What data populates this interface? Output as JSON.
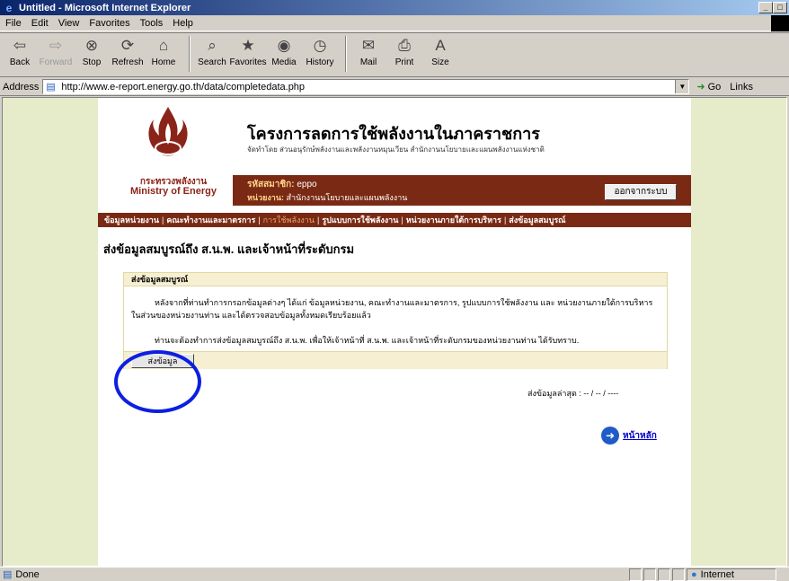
{
  "window": {
    "title": "Untitled - Microsoft Internet Explorer",
    "buttons": [
      "_",
      "ŏ"
    ]
  },
  "menu": [
    "File",
    "Edit",
    "View",
    "Favorites",
    "Tools",
    "Help"
  ],
  "toolbar": {
    "back": "Back",
    "forward": "Forward",
    "stop": "Stop",
    "refresh": "Refresh",
    "home": "Home",
    "search": "Search",
    "favorites": "Favorites",
    "media": "Media",
    "history": "History",
    "mail": "Mail",
    "print": "Print",
    "size": "Size"
  },
  "address": {
    "label": "Address",
    "url": "http://www.e-report.energy.go.th/data/completedata.php",
    "go": "Go",
    "links": "Links"
  },
  "header": {
    "ministry_th": "กระทรวงพลังงาน",
    "ministry_en": "Ministry of Energy",
    "project_title": "โครงการลดการใช้พลังงานในภาคราชการ",
    "project_sub": "จัดทำโดย ส่วนอนุรักษ์พลังงานและพลังงานหมุนเวียน สำนักงานนโยบายและแผนพลังงานแห่งชาติ"
  },
  "member": {
    "id_label": "รหัสสมาชิก:",
    "id_value": "eppo",
    "unit_label": "หน่วยงาน:",
    "unit_value": "สำนักงานนโยบายและแผนพลังงาน",
    "logout": "ออกจากระบบ"
  },
  "nav": [
    {
      "label": "ข้อมูลหน่วยงาน"
    },
    {
      "label": "คณะทำงานและมาตรการ"
    },
    {
      "label": "การใช้พลังงาน"
    },
    {
      "label": "รูปแบบการใช้พลังงาน"
    },
    {
      "label": "หน่วยงานภายใต้การบริหาร"
    },
    {
      "label": "ส่งข้อมูลสมบูรณ์"
    }
  ],
  "main": {
    "heading": "ส่งข้อมูลสมบูรณ์ถึง ส.น.พ. และเจ้าหน้าที่ระดับกรม",
    "panel_title": "ส่งข้อมูลสมบูรณ์",
    "para1": "หลังจากที่ท่านทำการกรอกข้อมูลต่างๆ ได้แก่ ข้อมูลหน่วยงาน, คณะทำงานและมาตรการ, รูปแบบการใช้พลังงาน และ หน่วยงานภายใต้การบริหาร ในส่วนของหน่วยงานท่าน และได้ตรวจสอบข้อมูลทั้งหมดเรียบร้อยแล้ว",
    "para2": "ท่านจะต้องทำการส่งข้อมูลสมบูรณ์ถึง ส.น.พ. เพื่อให้เจ้าหน้าที่ ส.น.พ. และเจ้าหน้าที่ระดับกรมของหน่วยงานท่าน ได้รับทราบ.",
    "send_button": "ส่งข้อมูล",
    "last_sent": "ส่งข้อมูลล่าสุด : -- / -- / ----",
    "home_link": "หน้าหลัก"
  },
  "status": {
    "text": "Done",
    "zone": "Internet"
  },
  "colors": {
    "brand": "#7a2a14",
    "highlight_circle": "#0d1fe0",
    "page_bg": "#e6ebc9"
  }
}
